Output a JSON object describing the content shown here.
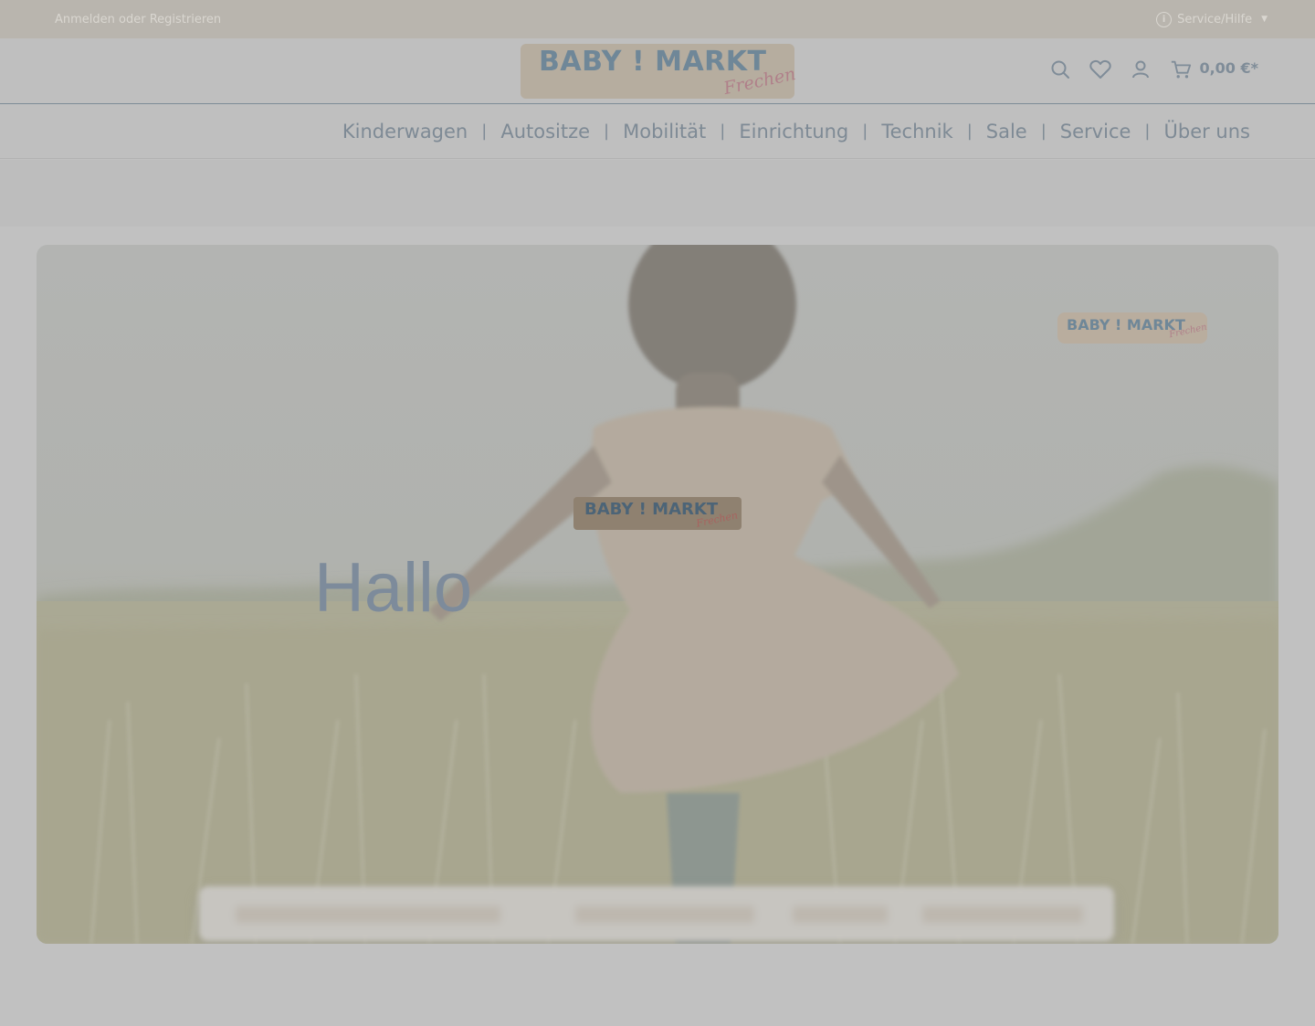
{
  "topbar": {
    "login_text": "Anmelden oder Registrieren",
    "service_label": "Service/Hilfe"
  },
  "header": {
    "logo_main": "BABY ! MARKT",
    "logo_sub": "Frechen",
    "cart_total": "0,00 €*",
    "icons": [
      "search-icon",
      "heart-icon",
      "user-icon",
      "cart-icon"
    ]
  },
  "nav": {
    "items": [
      "Kinderwagen",
      "Autositze",
      "Mobilität",
      "Einrichtung",
      "Technik",
      "Sale",
      "Service",
      "Über uns"
    ],
    "separator": "|"
  },
  "hero": {
    "logo_main": "BABY ! MARKT",
    "logo_sub": "Frechen",
    "greeting": "Hallo"
  },
  "colors": {
    "overlay_gray": "#c1c1c1",
    "topbar": "#b9b5ae",
    "nav_text": "#7e8a95",
    "accent_blue": "#6f8798"
  }
}
